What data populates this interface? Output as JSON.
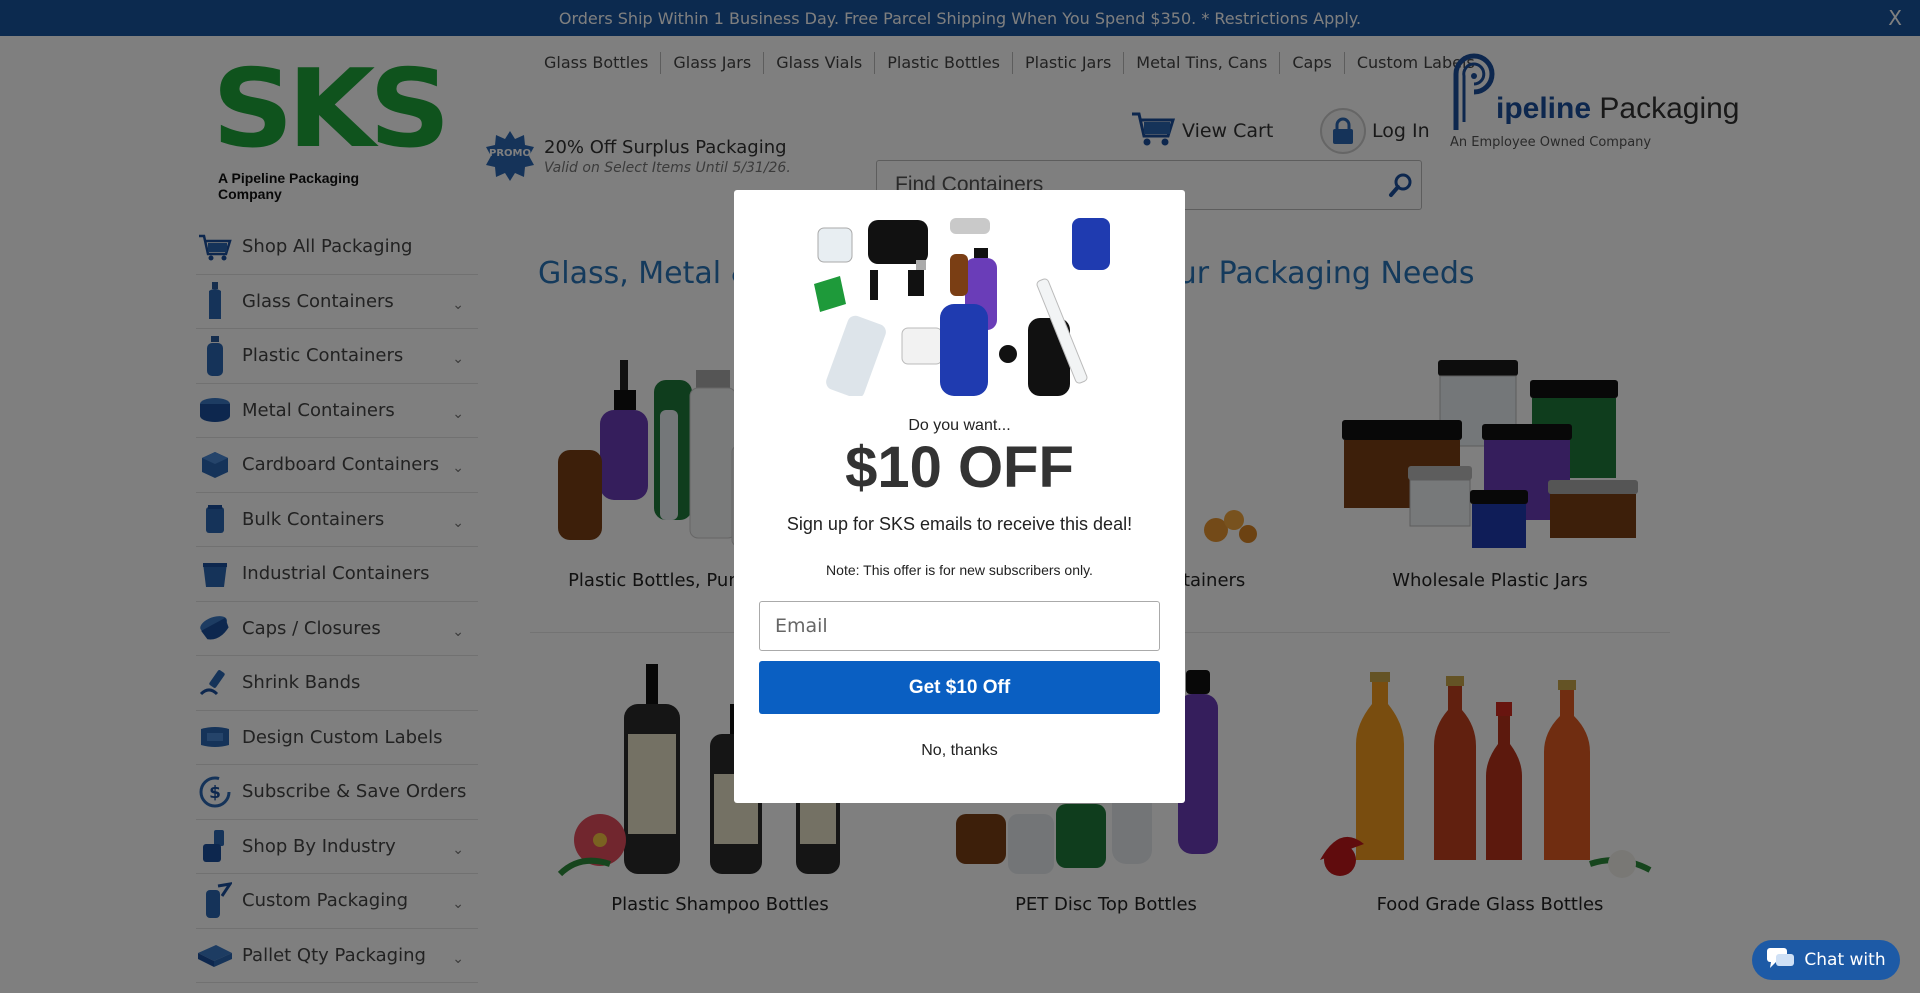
{
  "announcement": {
    "text": "Orders Ship Within 1 Business Day. Free Parcel Shipping When You Spend $350. * Restrictions Apply.",
    "close": "X"
  },
  "logo": {
    "letters": "SKS",
    "tagline": "A Pipeline Packaging Company"
  },
  "topnav": [
    "Glass Bottles",
    "Glass Jars",
    "Glass Vials",
    "Plastic Bottles",
    "Plastic Jars",
    "Metal Tins, Cans",
    "Caps",
    "Custom Labels"
  ],
  "promo": {
    "badge": "PROMO",
    "title": "20% Off Surplus Packaging",
    "subtitle": "Valid on Select Items Until 5/31/26."
  },
  "header": {
    "view_cart": "View Cart",
    "log_in": "Log In",
    "pipeline_name_bold": "ipeline",
    "pipeline_name_light": "Packaging",
    "pipeline_tagline": "An Employee Owned Company"
  },
  "search": {
    "placeholder": "Find Containers"
  },
  "sidebar": {
    "items": [
      {
        "label": "Shop All Packaging",
        "icon": "cart-icon",
        "chevron": false
      },
      {
        "label": "Glass Containers",
        "icon": "glass-bottle-icon",
        "chevron": true
      },
      {
        "label": "Plastic Containers",
        "icon": "plastic-bottle-icon",
        "chevron": true
      },
      {
        "label": "Metal Containers",
        "icon": "metal-tin-icon",
        "chevron": true
      },
      {
        "label": "Cardboard Containers",
        "icon": "box-icon",
        "chevron": true
      },
      {
        "label": "Bulk Containers",
        "icon": "bulk-container-icon",
        "chevron": true
      },
      {
        "label": "Industrial Containers",
        "icon": "industrial-bucket-icon",
        "chevron": false
      },
      {
        "label": "Caps / Closures",
        "icon": "cap-icon",
        "chevron": true
      },
      {
        "label": "Shrink Bands",
        "icon": "shrink-band-icon",
        "chevron": false
      },
      {
        "label": "Design Custom Labels",
        "icon": "label-icon",
        "chevron": false
      },
      {
        "label": "Subscribe & Save Orders",
        "icon": "dollar-icon",
        "chevron": false
      },
      {
        "label": "Shop By Industry",
        "icon": "industry-icon",
        "chevron": true
      },
      {
        "label": "Custom Packaging",
        "icon": "custom-packaging-icon",
        "chevron": true
      },
      {
        "label": "Pallet Qty Packaging",
        "icon": "pallet-icon",
        "chevron": true
      }
    ],
    "chevron_glyph": "⌄"
  },
  "main": {
    "title": "Glass, Metal & Plastic Containers For All Your Packaging Needs",
    "products": [
      {
        "label": "Plastic Bottles, Pumps & Sprayers"
      },
      {
        "label": "Glass Jars & Candle Containers"
      },
      {
        "label": "Wholesale Plastic Jars"
      },
      {
        "label": "Plastic Shampoo Bottles"
      },
      {
        "label": "PET Disc Top Bottles"
      },
      {
        "label": "Food Grade Glass Bottles"
      }
    ]
  },
  "modal": {
    "question": "Do you want...",
    "offer": "$10 OFF",
    "signup": "Sign up for SKS emails to receive this deal!",
    "note": "Note: This offer is for new subscribers only.",
    "email_placeholder": "Email",
    "cta": "Get $10 Off",
    "decline": "No, thanks"
  },
  "chat": {
    "label": "Chat with"
  },
  "colors": {
    "brand_blue": "#19559e",
    "sks_green": "#1fa63b",
    "title_blue": "#2874b8",
    "cta_blue": "#0a5fc2"
  }
}
